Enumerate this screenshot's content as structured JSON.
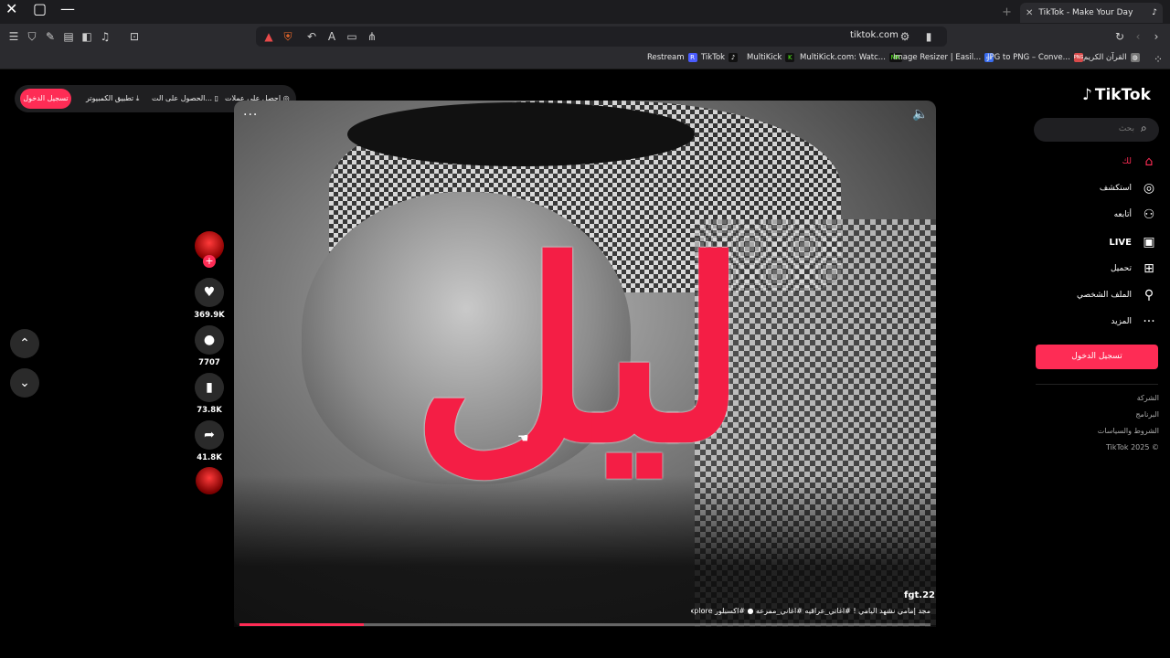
{
  "browser": {
    "tab_title": "TikTok - Make Your Day",
    "url": "tiktok.com",
    "bookmarks": [
      {
        "label": "Restream",
        "icon": "R",
        "color": "#4a5cff"
      },
      {
        "label": "TikTok",
        "icon": "♪",
        "color": "#111111"
      },
      {
        "label": "MultiKick",
        "icon": "K",
        "color": "#53fc18"
      },
      {
        "label": "MultiKick.com: Watc...",
        "icon": "MK",
        "color": "#53fc18"
      },
      {
        "label": "Image Resizer | Easil...",
        "icon": "▭",
        "color": "#3a6df0"
      },
      {
        "label": "JPG to PNG – Conve...",
        "icon": "PNG",
        "color": "#d84a4a"
      },
      {
        "label": "القرآن الكريم",
        "icon": "◍",
        "color": "#777777"
      }
    ]
  },
  "topbar": {
    "login": "تسجيل الدخول",
    "desktop_app": "تطبيق الكمبيوتر",
    "get_app": "الحصول على الت...",
    "get_coins": "احصل على عملات"
  },
  "video": {
    "overlay_text": "ليل",
    "username": "fgt.22",
    "caption": "مجد إمامي نشهد اليامي ! #اغاني_عراقيه #اغاني_ممرعه ● #اكسبلور explore",
    "progress": 0.18
  },
  "actions": {
    "likes": "369.9K",
    "comments": "7707",
    "saves": "73.8K",
    "shares": "41.8K"
  },
  "sidebar": {
    "logo": "TikTok",
    "search_placeholder": "بحث",
    "nav": [
      {
        "label": "لك",
        "icon": "home-icon",
        "glyph": "⌂",
        "active": true
      },
      {
        "label": "استكشف",
        "icon": "compass-icon",
        "glyph": "◎",
        "active": false
      },
      {
        "label": "أتابعه",
        "icon": "follow-user-icon",
        "glyph": "👤",
        "active": false
      },
      {
        "label": "LIVE",
        "icon": "live-tv-icon",
        "glyph": "▣",
        "active": false
      },
      {
        "label": "تحميل",
        "icon": "upload-icon",
        "glyph": "⊞",
        "active": false
      },
      {
        "label": "الملف الشخصي",
        "icon": "profile-icon",
        "glyph": "👤",
        "active": false
      },
      {
        "label": "المزيد",
        "icon": "more-icon",
        "glyph": "···",
        "active": false
      }
    ],
    "login_button": "تسجيل الدخول",
    "footer": [
      "الشركة",
      "البرنامج",
      "الشروط والسياسات",
      "TikTok 2025 ©"
    ]
  },
  "colors": {
    "accent": "#fe2c55",
    "overlay_red": "#f41e45"
  }
}
